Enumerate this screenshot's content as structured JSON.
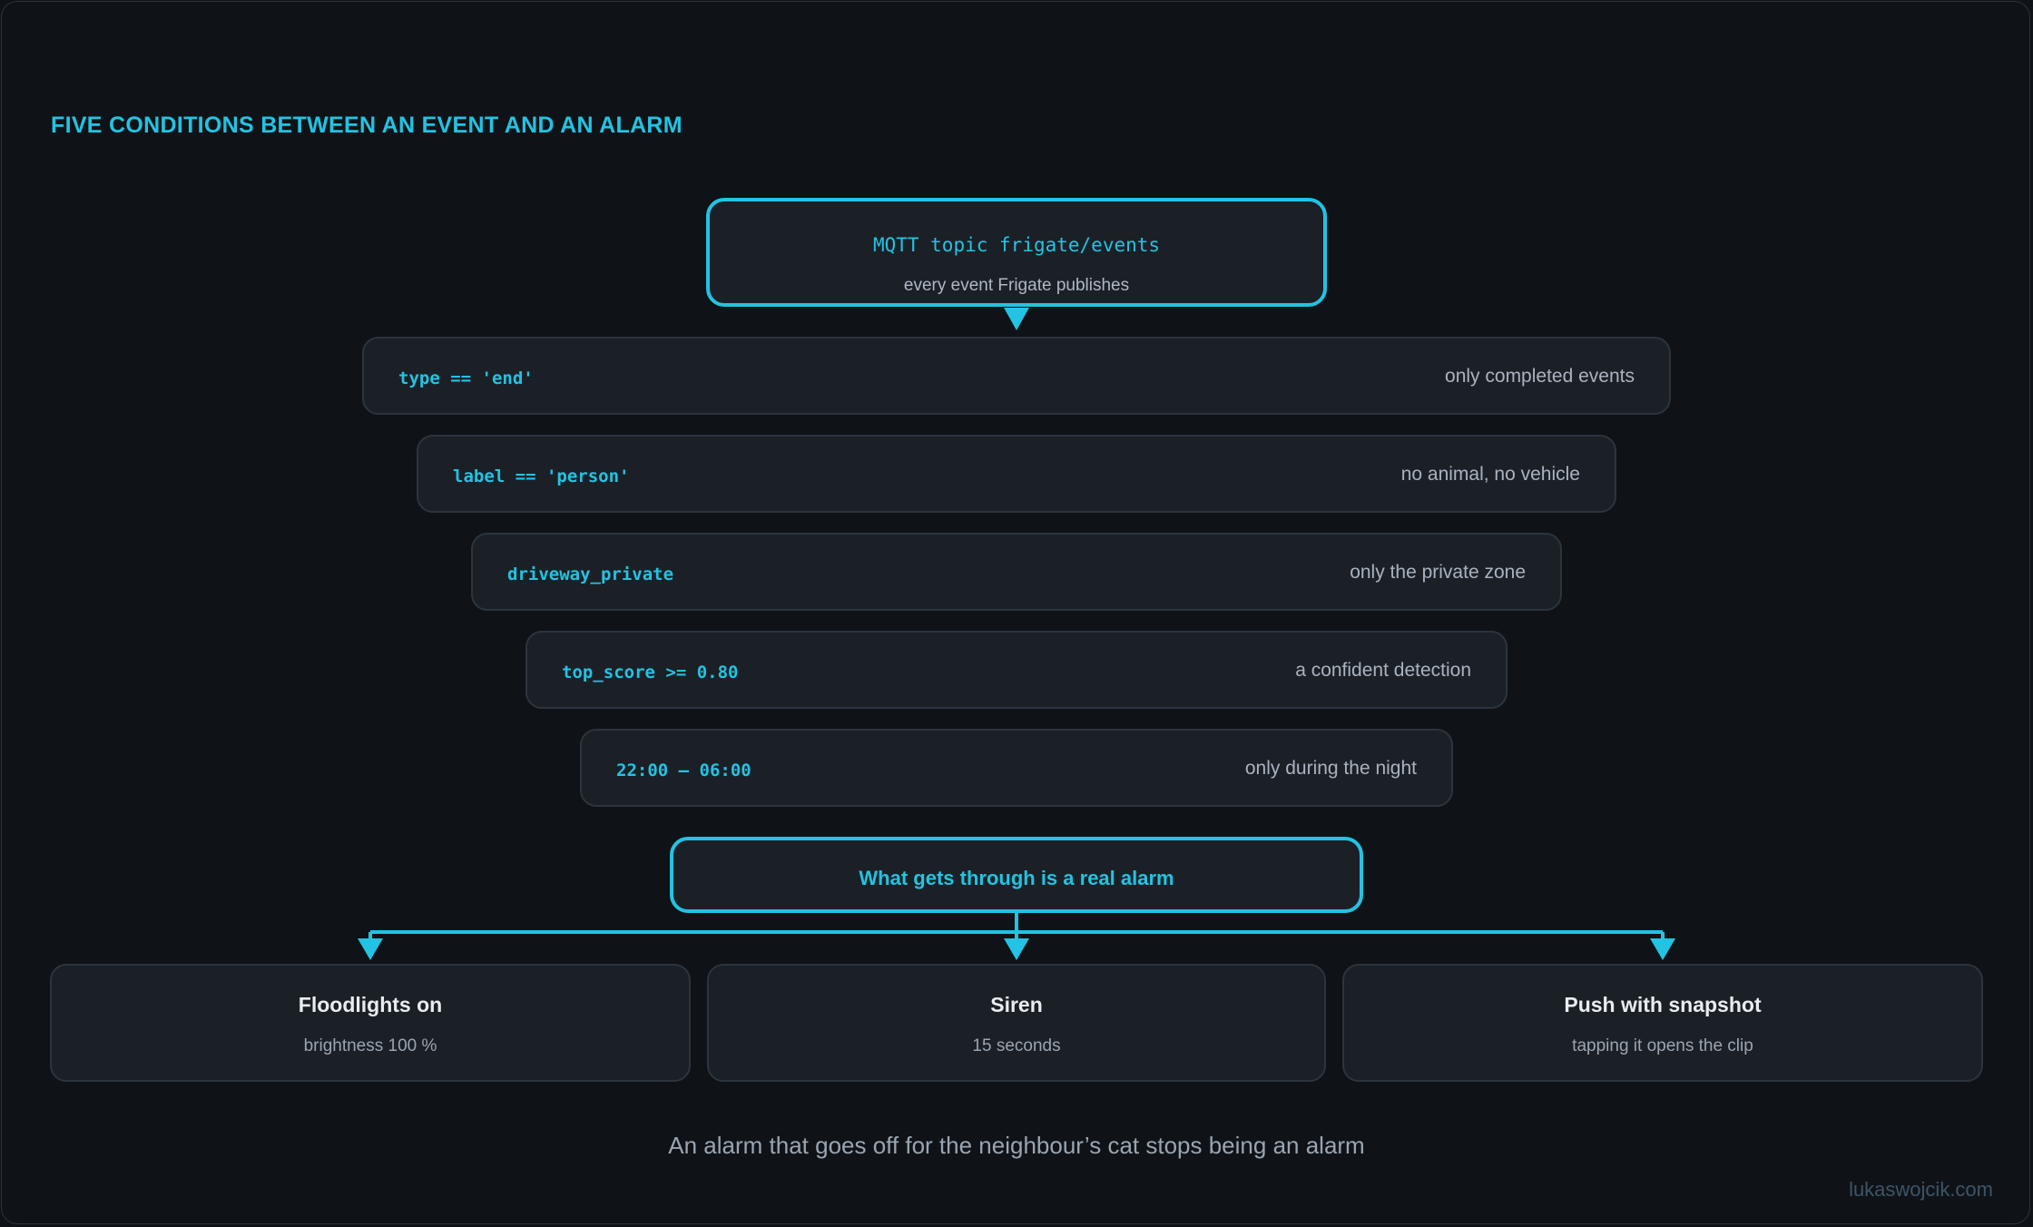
{
  "title": "FIVE CONDITIONS BETWEEN AN EVENT AND AN ALARM",
  "source": {
    "label": "MQTT topic frigate/events",
    "sublabel": "every event Frigate publishes"
  },
  "conditions": [
    {
      "code": "type == 'end'",
      "note": "only completed events"
    },
    {
      "code": "label == 'person'",
      "note": "no animal, no vehicle"
    },
    {
      "code": "driveway_private",
      "note": "only the private zone"
    },
    {
      "code": "top_score >= 0.80",
      "note": "a confident detection"
    },
    {
      "code": "22:00 – 06:00",
      "note": "only during the night"
    }
  ],
  "result": {
    "label": "What gets through is a real alarm"
  },
  "outputs": [
    {
      "title": "Floodlights on",
      "subtitle": "brightness 100 %"
    },
    {
      "title": "Siren",
      "subtitle": "15 seconds"
    },
    {
      "title": "Push with snapshot",
      "subtitle": "tapping it opens the clip"
    }
  ],
  "footer": "An alarm that goes off for the neighbour’s cat stops being an alarm",
  "credit": "lukaswojcik.com",
  "colors": {
    "accent": "#22c3e3",
    "background": "#0f1317",
    "box": "#1b2026"
  }
}
